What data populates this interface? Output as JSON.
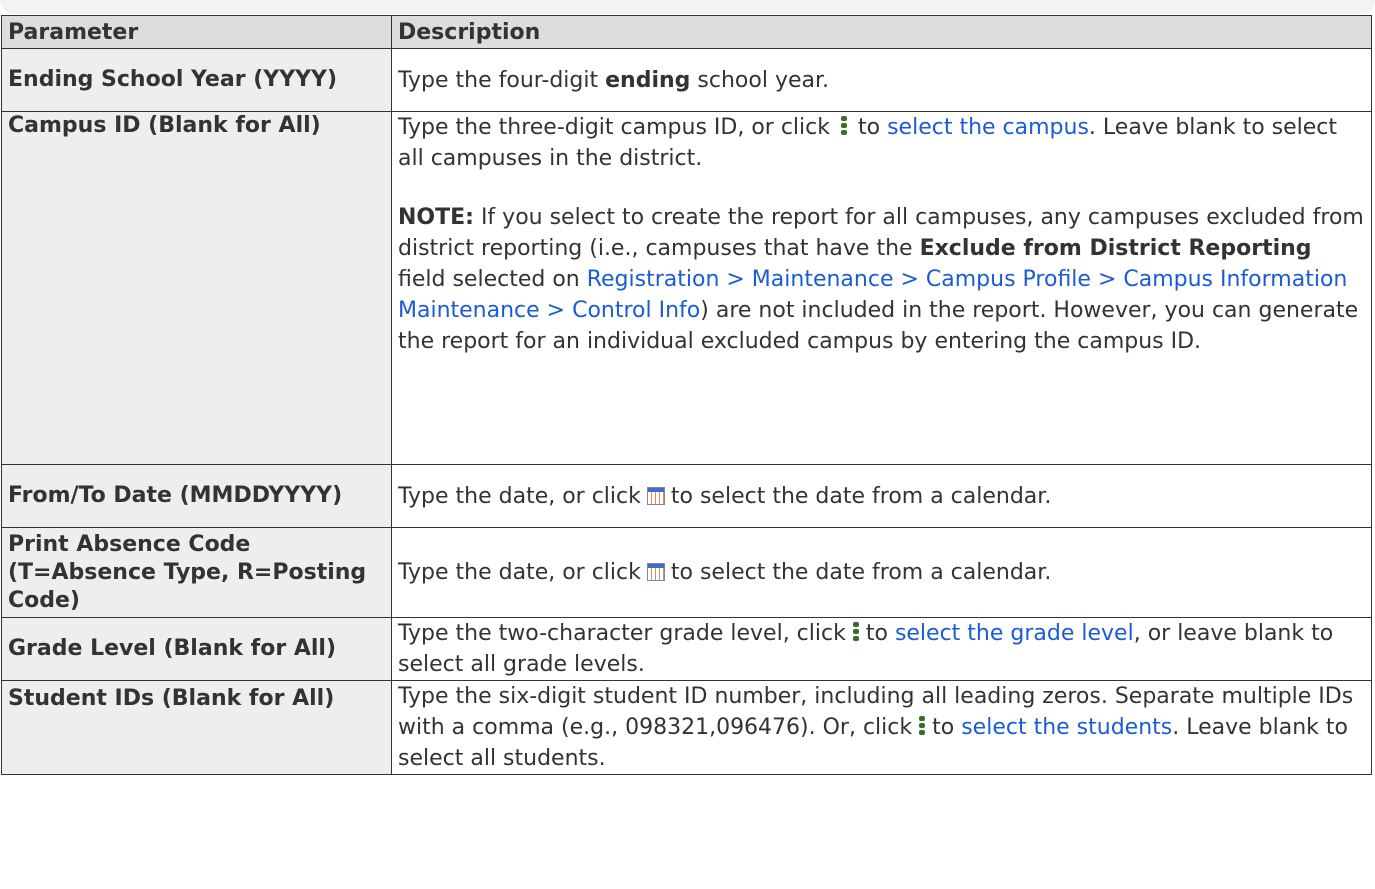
{
  "header": {
    "col1": "Parameter",
    "col2": "Description"
  },
  "rows": {
    "ending_year": {
      "name": "Ending School Year (YYYY)",
      "pre": "Type the four-digit ",
      "bold": "ending",
      "post": " school year."
    },
    "campus_id": {
      "name": "Campus ID (Blank for All)",
      "pre": "Type the three-digit campus ID, or click",
      "mid": "to",
      "link": "select the campus",
      "post": ". Leave blank to select all campuses in the district.",
      "note_label": "NOTE:",
      "note_pre": " If you select to create the report for all campuses, any campuses excluded from district reporting (i.e., campuses that have the ",
      "note_bold": "Exclude from District Reporting",
      "note_mid": " field selected on ",
      "note_link": "Registration > Maintenance > Campus Profile > Campus Information Maintenance > Control Info",
      "note_post": ") are not included in the report. However, you can generate the report for an individual excluded campus by entering the campus ID."
    },
    "from_to_date": {
      "name": "From/To Date (MMDDYYYY)",
      "pre": "Type the date, or click",
      "post": "to select the date from a calendar."
    },
    "print_absence": {
      "name": "Print Absence Code (T=Absence Type, R=Posting Code)",
      "pre": "Type the date, or click",
      "post": "to select the date from a calendar."
    },
    "grade_level": {
      "name": "Grade Level (Blank for All)",
      "pre": "Type the two-character grade level, click",
      "mid": "to",
      "link": "select the grade level",
      "post": ", or leave blank to select all grade levels."
    },
    "student_ids": {
      "name": "Student IDs (Blank for All)",
      "pre": "Type the six-digit student ID number, including all leading zeros. Separate multiple IDs with a comma (e.g., 098321,096476). Or, click",
      "mid": "to",
      "link": "select the students",
      "post": ". Leave blank to select all students."
    }
  },
  "icons": {
    "lookup": "vertical-dots-lookup-icon",
    "calendar": "calendar-icon"
  },
  "colors": {
    "link": "#1a5cd8",
    "header_bg": "#dddddd",
    "param_bg": "#eeeeee",
    "lookup_icon": "#3a6f2a"
  }
}
